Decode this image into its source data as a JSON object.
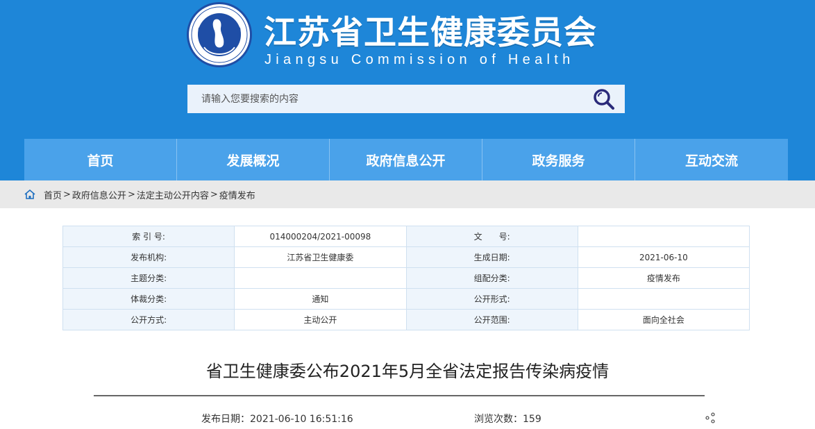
{
  "header": {
    "title_cn": "江苏省卫生健康委员会",
    "title_en": "Jiangsu Commission of Health",
    "logo_icon": "emblem-logo-icon",
    "colors": {
      "header_bg": "#1e86d8",
      "nav_bg": "#4aa2ea",
      "search_icon": "#2a2a7a"
    }
  },
  "search": {
    "placeholder": "请输入您要搜索的内容",
    "icon": "search-icon"
  },
  "nav": {
    "items": [
      {
        "label": "首页"
      },
      {
        "label": "发展概况"
      },
      {
        "label": "政府信息公开"
      },
      {
        "label": "政务服务"
      },
      {
        "label": "互动交流"
      }
    ]
  },
  "breadcrumb": {
    "icon": "home-icon",
    "items": [
      "首页",
      "政府信息公开",
      "法定主动公开内容",
      "疫情发布"
    ],
    "separator": ">"
  },
  "meta": {
    "rows": [
      [
        {
          "k": "索 引 号:",
          "v": "014000204/2021-00098"
        },
        {
          "k": "文　　号:",
          "v": ""
        }
      ],
      [
        {
          "k": "发布机构:",
          "v": "江苏省卫生健康委"
        },
        {
          "k": "生成日期:",
          "v": "2021-06-10"
        }
      ],
      [
        {
          "k": "主题分类:",
          "v": ""
        },
        {
          "k": "组配分类:",
          "v": "疫情发布"
        }
      ],
      [
        {
          "k": "体裁分类:",
          "v": "通知"
        },
        {
          "k": "公开形式:",
          "v": ""
        }
      ],
      [
        {
          "k": "公开方式:",
          "v": "主动公开"
        },
        {
          "k": "公开范围:",
          "v": "面向全社会"
        }
      ]
    ]
  },
  "article": {
    "title": "省卫生健康委公布2021年5月全省法定报告传染病疫情",
    "date_label": "发布日期：",
    "date_value": "2021-06-10 16:51:16",
    "views_label": "浏览次数：",
    "views_value": "159",
    "share_icon": "share-icon"
  }
}
